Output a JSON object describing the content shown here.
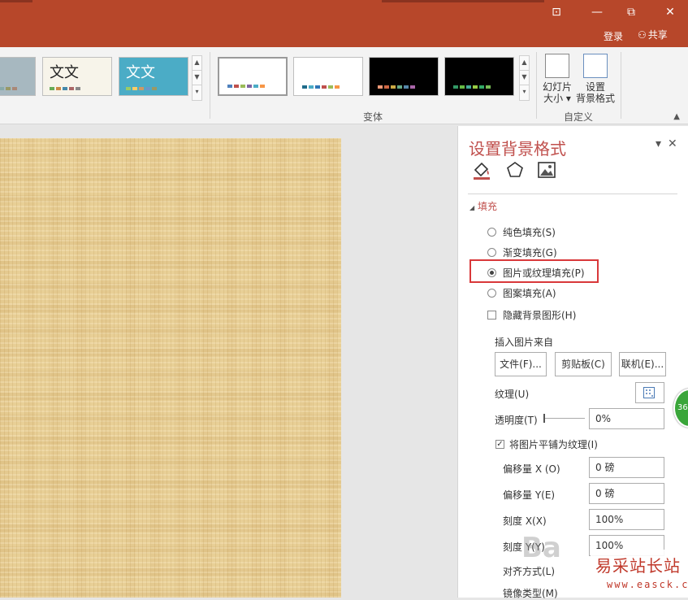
{
  "window": {
    "login_label": "登录",
    "share_label": "共享",
    "controls": [
      "restore-to-window",
      "minimize",
      "maximize",
      "close"
    ]
  },
  "ribbon": {
    "theme_previews": [
      {
        "text": "",
        "bg": "#a7b8c0"
      },
      {
        "text": "文文",
        "bg": "#f7f4ea"
      },
      {
        "text": "文文",
        "bg": "#4bacc6"
      }
    ],
    "variants_group_label": "变体",
    "customize_group_label": "自定义",
    "slide_size_label_1": "幻灯片",
    "slide_size_label_2": "大小",
    "format_bg_label_1": "设置",
    "format_bg_label_2": "背景格式"
  },
  "pane": {
    "title": "设置背景格式",
    "section_fill": "填充",
    "fill_options": [
      {
        "label": "纯色填充(S)",
        "selected": false
      },
      {
        "label": "渐变填充(G)",
        "selected": false
      },
      {
        "label": "图片或纹理填充(P)",
        "selected": true
      },
      {
        "label": "图案填充(A)",
        "selected": false
      }
    ],
    "hide_bg_graphics": "隐藏背景图形(H)",
    "insert_from": "插入图片来自",
    "btn_file": "文件(F)...",
    "btn_clipboard": "剪贴板(C)",
    "btn_online": "联机(E)...",
    "texture_label": "纹理(U)",
    "transparency_label": "透明度(T)",
    "transparency_value": "0%",
    "tile_label": "将图片平铺为纹理(I)",
    "offset_x_label": "偏移量 X (O)",
    "offset_x_value": "0 磅",
    "offset_y_label": "偏移量 Y(E)",
    "offset_y_value": "0 磅",
    "scale_x_label": "刻度 X(X)",
    "scale_x_value": "100%",
    "scale_y_label": "刻度 Y(Y)",
    "scale_y_value": "100%",
    "align_label": "对齐方式(L)",
    "mirror_label": "镜像类型(M)"
  },
  "overlay": {
    "badge_text": "36",
    "watermark_cn": "易采站长站",
    "watermark_url": "www.easck.com",
    "baidu_text": "Ba"
  },
  "colors": {
    "title_bar": "#b7472a",
    "accent_text": "#c0504d",
    "highlight_box": "#d9383a"
  }
}
